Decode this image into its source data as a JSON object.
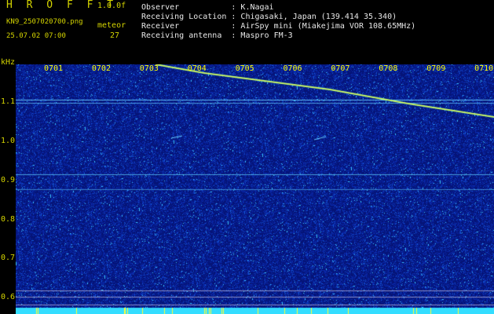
{
  "header": {
    "title": "H R O F F T",
    "version": "1.0.0f",
    "filename": "KN9_2507020700.png",
    "datetime": "25.07.02 07:00",
    "meteor_label": "meteor",
    "meteor_count": "27"
  },
  "info": {
    "observer": "Observer           : K.Nagai",
    "location": "Receiving Location : Chigasaki, Japan (139.414 35.340)",
    "receiver": "Receiver           : AirSpy mini (Miakejima VOR 108.65MHz)",
    "antenna": "Receiving antenna  : Maspro FM-3"
  },
  "axis": {
    "y_unit": "kHz",
    "y_labels": [
      "1.1",
      "1.0",
      "0.9",
      "0.8",
      "0.7",
      "0.6"
    ],
    "x_labels": [
      "0701",
      "0702",
      "0703",
      "0704",
      "0705",
      "0706",
      "0707",
      "0708",
      "0709",
      "0710"
    ]
  },
  "colors": {
    "background": "#000000",
    "spectrogram_bg": "#0a1a8a",
    "label": "#d4d400",
    "text": "#e8e8e8",
    "trace": "#7fff7f"
  }
}
